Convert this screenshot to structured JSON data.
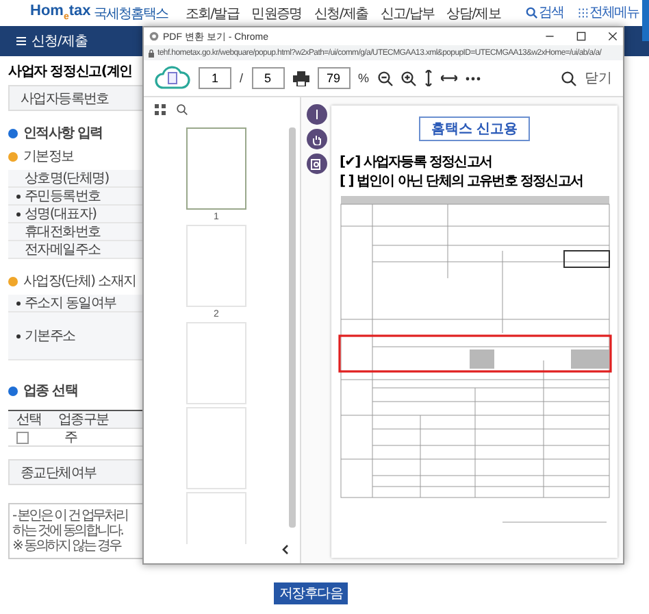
{
  "header": {
    "logo": "Hom$_{e}$tax",
    "logo_sub": "국세청홈택스",
    "nav": [
      {
        "label": "조회/발급"
      },
      {
        "label": "민원증명"
      },
      {
        "label": "신청/제출"
      },
      {
        "label": "신고/납부"
      },
      {
        "label": "상담/제보"
      }
    ],
    "tools": [
      {
        "kind": "search",
        "label": "검색"
      },
      {
        "kind": "menu",
        "label": "전체메뉴"
      }
    ]
  },
  "menu_bar": {
    "label": "신청/제출"
  },
  "page": {
    "title": "사업자 정정신고(계인",
    "reg_label": "사업자등록번호",
    "section1": "인적사항 입력",
    "basic": {
      "title": "기본정보",
      "rows": [
        {
          "label": "상호명(단체명)",
          "required": false
        },
        {
          "label": "주민등록번호",
          "required": true
        },
        {
          "label": "성명(대표자)",
          "required": true
        },
        {
          "label": "휴대전화번호",
          "required": false
        },
        {
          "label": "전자메일주소",
          "required": false
        }
      ]
    },
    "address": {
      "title": "사업장(단체) 소재지",
      "rows": [
        {
          "label": "주소지 동일여부",
          "required": true,
          "tall": false
        },
        {
          "label": "기본주소",
          "required": true,
          "tall": true
        }
      ]
    },
    "section2": "업종 선택",
    "table": {
      "columns": [
        "선택",
        "업종구분"
      ],
      "rows": [
        {
          "checked": false,
          "type": "주"
        }
      ]
    },
    "religious_label": "종교단체여부",
    "notice": [
      "- 본인은 이 건 업무처리",
      "하는 것에 동의합니다.",
      "※ 동의하지 않는 경우"
    ],
    "next_button": "저장후다음"
  },
  "popup": {
    "title": "PDF 변환 보기 - Chrome",
    "url": "tehf.hometax.go.kr/webquare/popup.html?w2xPath=/ui/comm/g/a/UTECMGAA13.xml&popupID=UTECMGAA13&w2xHome=/ui/ab/a/a/",
    "page": "1",
    "page_sep": "/",
    "page_total": "5",
    "zoom": "79",
    "zoom_unit": "%",
    "close": "닫기",
    "thumbnails": [
      {
        "label": "1",
        "selected": true
      },
      {
        "label": "2",
        "selected": false
      },
      {
        "selected": false
      },
      {
        "selected": false
      },
      {
        "selected": false
      }
    ],
    "document": {
      "stamp": "홈택스 신고용",
      "titles": [
        "[✔] 사업자등록 정정신고서",
        "[  ] 법인이 아닌 단체의 고유번호 정정신고서"
      ]
    }
  }
}
